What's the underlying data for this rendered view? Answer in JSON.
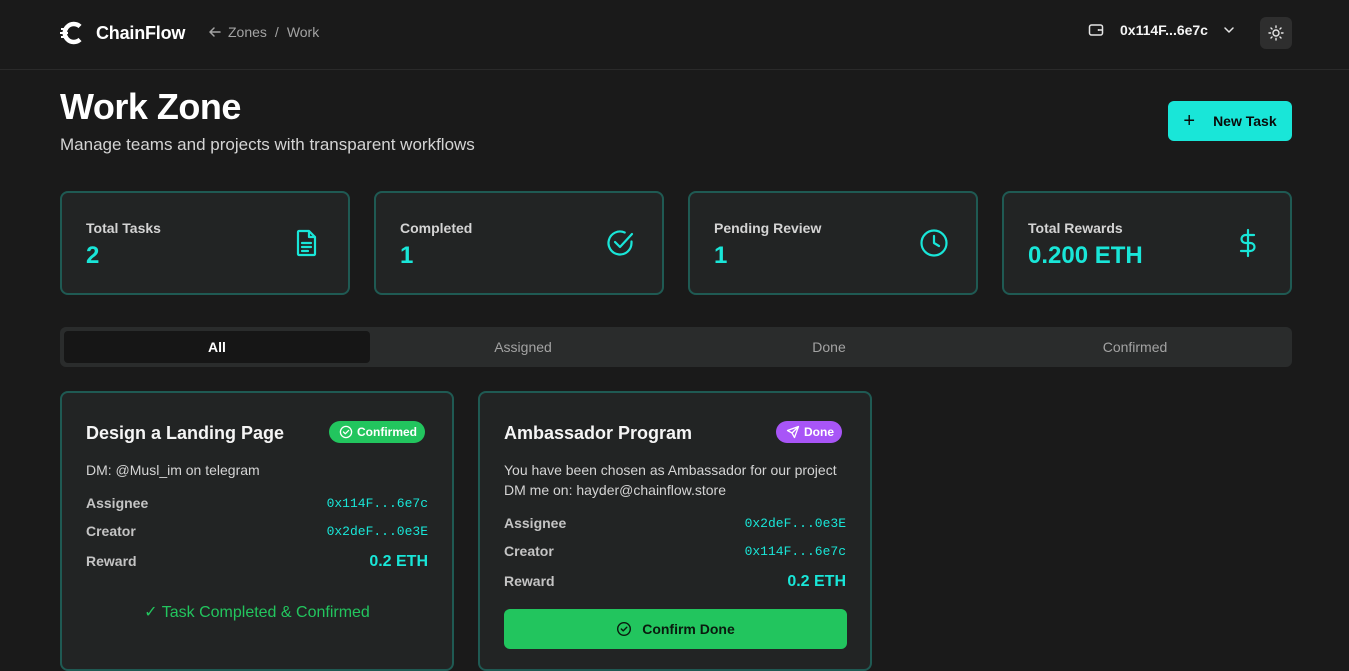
{
  "brand": {
    "name": "ChainFlow"
  },
  "breadcrumb": {
    "parent": "Zones",
    "separator": "/",
    "current": "Work"
  },
  "wallet": {
    "address": "0x114F...6e7c"
  },
  "page": {
    "title": "Work Zone",
    "subtitle": "Manage teams and projects with transparent workflows",
    "new_task_label": "New Task"
  },
  "stats": [
    {
      "label": "Total Tasks",
      "value": "2",
      "icon": "document-icon"
    },
    {
      "label": "Completed",
      "value": "1",
      "icon": "check-circle-icon"
    },
    {
      "label": "Pending Review",
      "value": "1",
      "icon": "clock-icon"
    },
    {
      "label": "Total Rewards",
      "value": "0.200 ETH",
      "icon": "dollar-icon"
    }
  ],
  "tabs": [
    {
      "label": "All",
      "active": true
    },
    {
      "label": "Assigned",
      "active": false
    },
    {
      "label": "Done",
      "active": false
    },
    {
      "label": "Confirmed",
      "active": false
    }
  ],
  "labels": {
    "assignee": "Assignee",
    "creator": "Creator",
    "reward": "Reward"
  },
  "tasks": [
    {
      "title": "Design a Landing Page",
      "status": "Confirmed",
      "description": "DM: @Musl_im on telegram",
      "assignee": "0x114F...6e7c",
      "creator": "0x2deF...0e3E",
      "reward": "0.2 ETH",
      "footer_message": "✓ Task Completed & Confirmed"
    },
    {
      "title": "Ambassador Program",
      "status": "Done",
      "description": "You have been chosen as Ambassador for our project DM me on: hayder@chainflow.store",
      "assignee": "0x2deF...0e3E",
      "creator": "0x114F...6e7c",
      "reward": "0.2 ETH",
      "action_label": "Confirm Done"
    }
  ],
  "colors": {
    "accent": "#19e6d8",
    "success": "#22c55e",
    "done": "#a855f7",
    "background": "#1a1a1a",
    "card": "#222424",
    "card_border": "#1f5a53"
  }
}
